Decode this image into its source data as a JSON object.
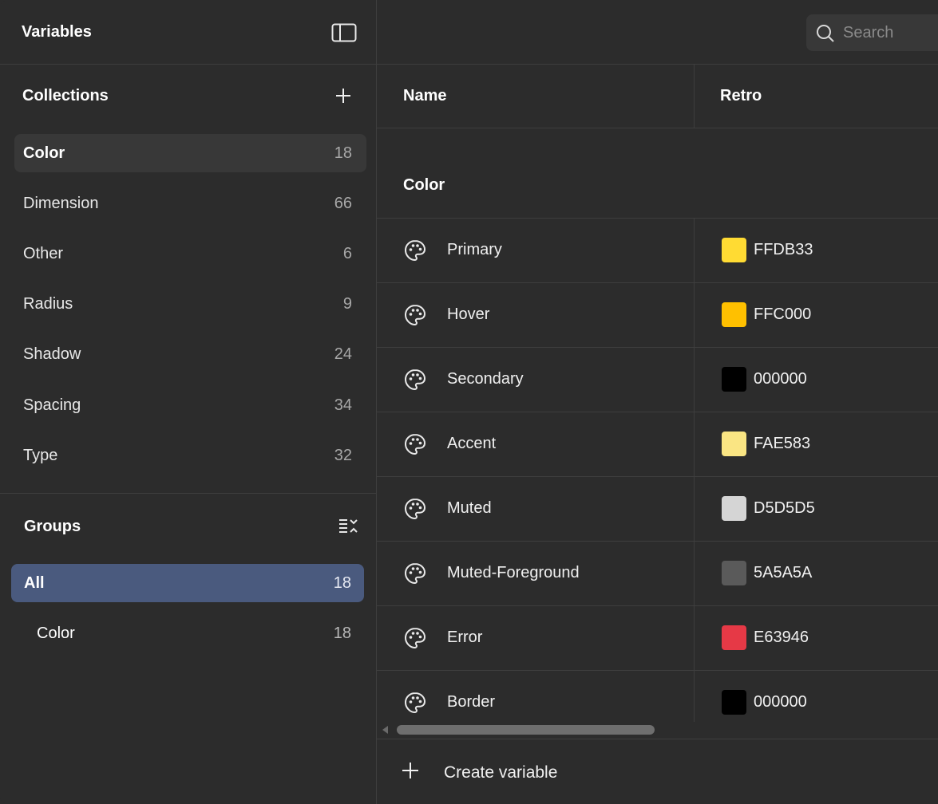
{
  "sidebar": {
    "title": "Variables",
    "toggle_icon": "sidebar-panel-icon",
    "collections": {
      "label": "Collections",
      "add_icon": "plus-icon",
      "items": [
        {
          "name": "Color",
          "count": "18",
          "active": true
        },
        {
          "name": "Dimension",
          "count": "66"
        },
        {
          "name": "Other",
          "count": "6"
        },
        {
          "name": "Radius",
          "count": "9"
        },
        {
          "name": "Shadow",
          "count": "24"
        },
        {
          "name": "Spacing",
          "count": "34"
        },
        {
          "name": "Type",
          "count": "32"
        }
      ]
    },
    "groups": {
      "label": "Groups",
      "collapse_icon": "collapse-list-icon",
      "items": [
        {
          "name": "All",
          "count": "18",
          "active": true
        },
        {
          "name": "Color",
          "count": "18"
        }
      ]
    }
  },
  "main": {
    "search": {
      "placeholder": "Search",
      "value": "",
      "icon": "search-icon"
    },
    "columns": {
      "name": "Name",
      "mode": "Retro"
    },
    "group_title": "Color",
    "variables": [
      {
        "name": "Primary",
        "value": "FFDB33",
        "color": "#FFDB33",
        "icon": "palette-icon"
      },
      {
        "name": "Hover",
        "value": "FFC000",
        "color": "#FFC000",
        "icon": "palette-icon"
      },
      {
        "name": "Secondary",
        "value": "000000",
        "color": "#000000",
        "icon": "palette-icon"
      },
      {
        "name": "Accent",
        "value": "FAE583",
        "color": "#FAE583",
        "icon": "palette-icon"
      },
      {
        "name": "Muted",
        "value": "D5D5D5",
        "color": "#D5D5D5",
        "icon": "palette-icon"
      },
      {
        "name": "Muted-Foreground",
        "value": "5A5A5A",
        "color": "#5A5A5A",
        "icon": "palette-icon"
      },
      {
        "name": "Error",
        "value": "E63946",
        "color": "#E63946",
        "icon": "palette-icon"
      },
      {
        "name": "Border",
        "value": "000000",
        "color": "#000000",
        "icon": "palette-icon"
      }
    ],
    "create_button": {
      "label": "Create variable",
      "icon": "plus-icon"
    }
  },
  "colors": {
    "background": "#2c2c2c",
    "border": "#3e3e3e",
    "active_item": "#383838",
    "selected_group": "#4a5a7e"
  }
}
